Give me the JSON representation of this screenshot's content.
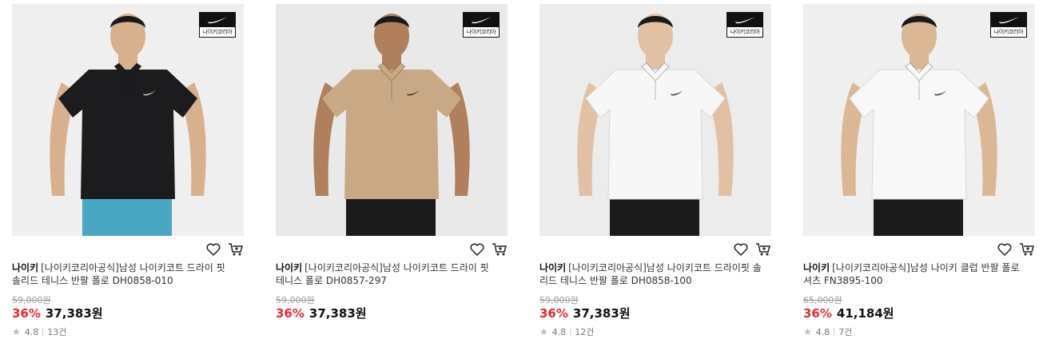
{
  "products": [
    {
      "badge_text": "나이키코리아",
      "brand": "나이키",
      "name": "[나이키코리아공식]남성 나이키코트 드라이 핏 솔리드 테니스 반팔 폴로 DH0858-010",
      "original_price": "59,000원",
      "discount": "36%",
      "price": "37,383원",
      "rating": "4.8",
      "reviews": "13건",
      "shirt_color": "#1c1c1e",
      "shorts_color": "#49a7c4",
      "skin_color": "#d8b08e",
      "bg_color": "#efefef"
    },
    {
      "badge_text": "나이키코리아",
      "brand": "나이키",
      "name": "[나이키코리아공식]남성 나이키코트 드라이 핏 테니스 폴로 DH0857-297",
      "original_price": "59,000원",
      "discount": "36%",
      "price": "37,383원",
      "rating": "",
      "reviews": "",
      "shirt_color": "#c9a985",
      "shorts_color": "#1b1b1b",
      "skin_color": "#b07f5c",
      "bg_color": "#e9e9e9"
    },
    {
      "badge_text": "나이키코리아",
      "brand": "나이키",
      "name": "[나이키코리아공식]남성 나이키코트 드라이핏 솔리드 테니스 반팔 폴로 DH0858-100",
      "original_price": "59,000원",
      "discount": "36%",
      "price": "37,383원",
      "rating": "4.8",
      "reviews": "12건",
      "shirt_color": "#f7f7f7",
      "shorts_color": "#1b1b1b",
      "skin_color": "#e2c0a3",
      "bg_color": "#ececec"
    },
    {
      "badge_text": "나이키코리아",
      "brand": "나이키",
      "name": "[나이키코리아공식]남성 나이키 클럽 반팔 폴로 셔츠 FN3895-100",
      "original_price": "65,000원",
      "discount": "36%",
      "price": "41,184원",
      "rating": "4.8",
      "reviews": "7건",
      "shirt_color": "#f8f8f8",
      "shorts_color": "#1b1b1b",
      "skin_color": "#dcb795",
      "bg_color": "#efefef"
    }
  ]
}
